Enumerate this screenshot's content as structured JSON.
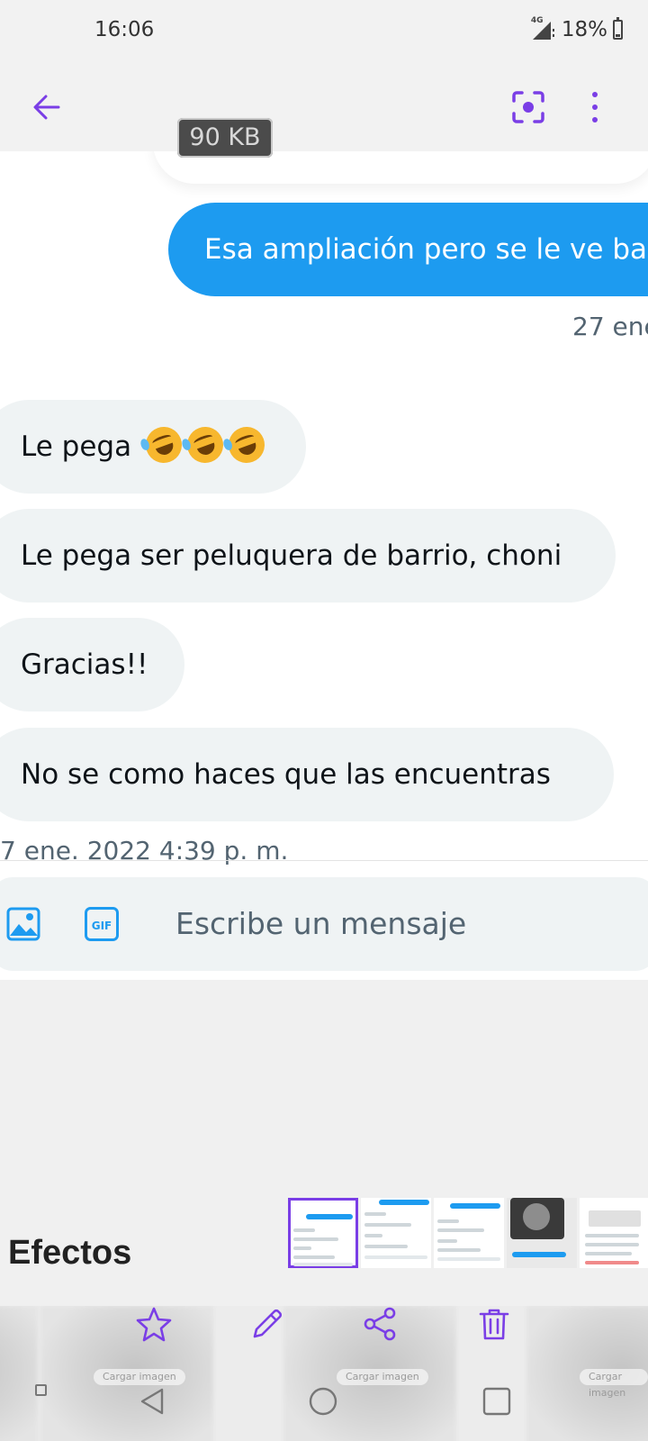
{
  "status_bar": {
    "time": "16:06",
    "network": "4G",
    "battery_percent": "18%",
    "battery_level": 0.18
  },
  "toolbar": {
    "back_icon": "arrow-left-icon",
    "scan_icon": "scan-focus-icon",
    "menu_icon": "more-vertical-icon",
    "accent_color": "#7a3ee6"
  },
  "preview": {
    "file_size": "90 KB",
    "messages": [
      {
        "direction": "out",
        "text": "Esa ampliación pero se le ve ba"
      },
      {
        "direction": "in",
        "text": "Le pega",
        "emoji": "rolling-on-floor-laughing x3"
      },
      {
        "direction": "in",
        "text": "Le pega ser peluquera de barrio, choni"
      },
      {
        "direction": "in",
        "text": "Gracias!!"
      },
      {
        "direction": "in",
        "text": "No se como haces que las encuentras"
      }
    ],
    "timestamps": {
      "outgoing": "27 ene",
      "incoming": "7 ene. 2022 4:39 p. m."
    },
    "compose": {
      "placeholder": "Escribe un mensaje",
      "image_icon": "image-icon",
      "gif_icon": "gif-icon",
      "gif_label": "GIF"
    },
    "colors": {
      "outgoing_bubble": "#1d9bf0",
      "incoming_bubble": "#eff3f4"
    }
  },
  "effects": {
    "title": "Efectos",
    "thumbnails_selected_index": 0
  },
  "blurred_labels": [
    "Cargar imagen",
    "Cargar imagen",
    "Cargar imagen"
  ],
  "actions": {
    "favorite_icon": "star-icon",
    "edit_icon": "pencil-icon",
    "share_icon": "share-icon",
    "delete_icon": "trash-icon"
  },
  "navigation": {
    "back": "nav-back-icon",
    "home": "nav-home-icon",
    "recents": "nav-recents-icon"
  }
}
